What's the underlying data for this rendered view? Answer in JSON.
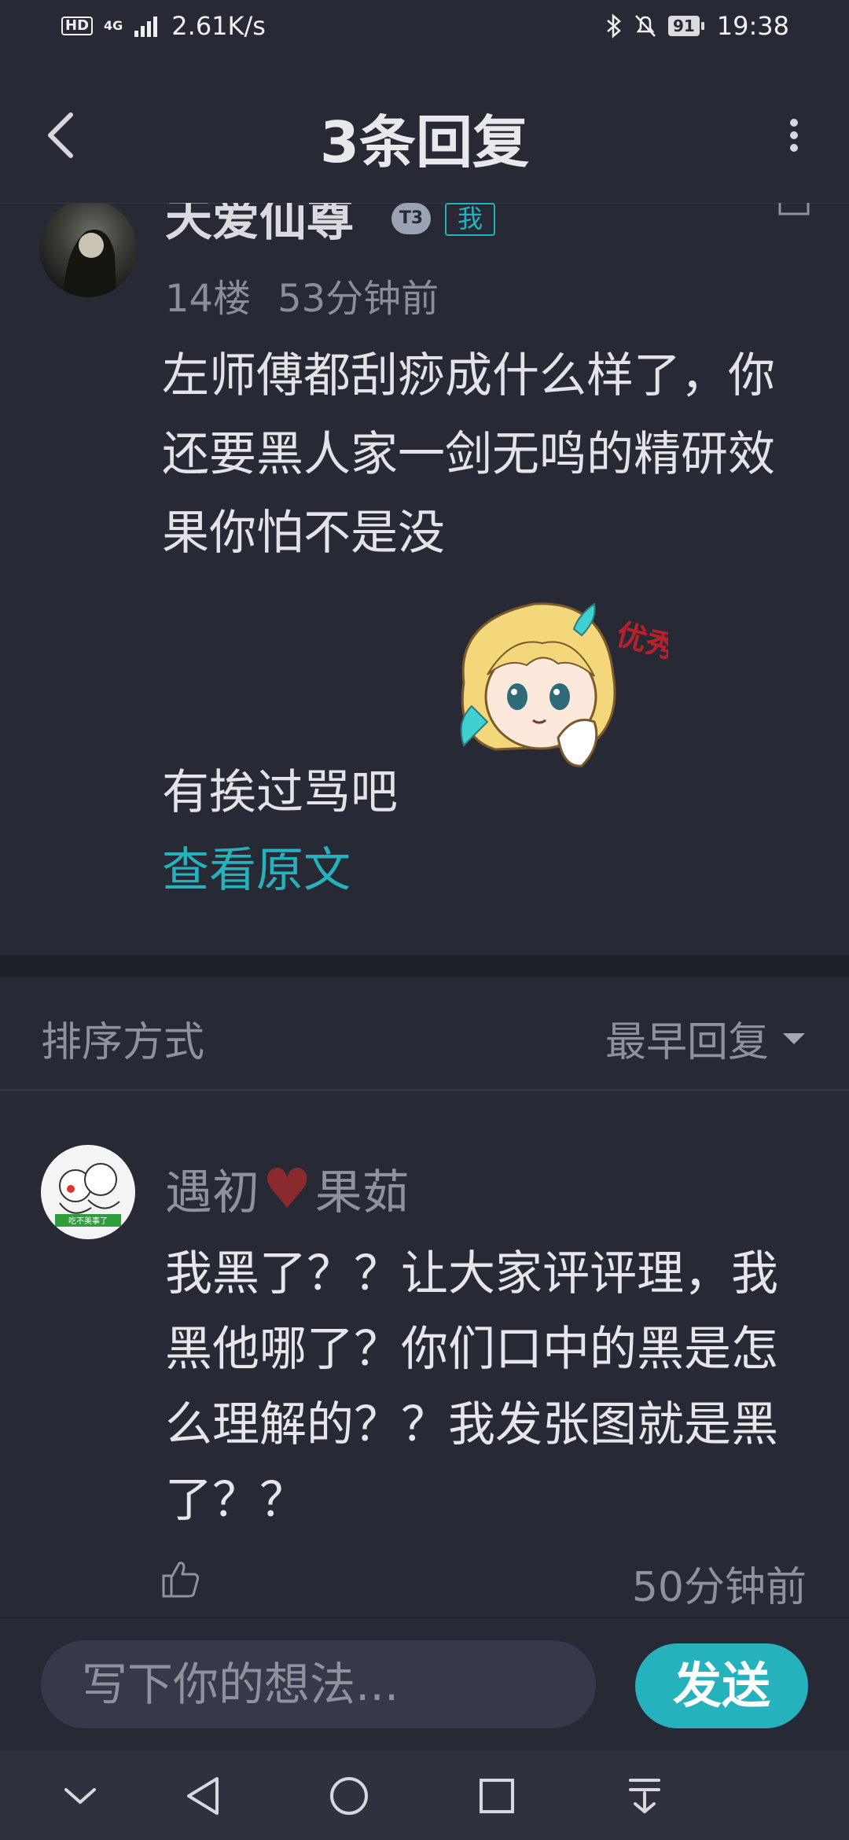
{
  "status_bar": {
    "hd": "HD",
    "network": "4G",
    "speed": "2.61K/s",
    "battery": "91",
    "time": "19:38"
  },
  "header": {
    "title": "3条回复"
  },
  "post": {
    "author": "天爱仙尊",
    "level_badge": "T3",
    "me_badge": "我",
    "floor": "14楼",
    "time": "53分钟前",
    "text_part1": "左师傅都刮痧成什么样了，你还要黑人家一剑无鸣的精研效果你怕不是没",
    "text_part2": "有挨过骂吧",
    "sticker_caption": "优秀",
    "view_original": "查看原文"
  },
  "sort": {
    "label": "排序方式",
    "value": "最早回复"
  },
  "reply": {
    "name_part1": "遇初",
    "heart": "♥",
    "name_part2": "果茹",
    "avatar_caption": "吃不美事了",
    "text": "我黑了？？让大家评评理，我黑他哪了？你们口中的黑是怎么理解的？？我发张图就是黑了？？",
    "time": "50分钟前"
  },
  "input": {
    "placeholder": "写下你的想法..."
  },
  "send_label": "发送",
  "colors": {
    "background": "#272a35",
    "accent": "#26b2bd"
  }
}
